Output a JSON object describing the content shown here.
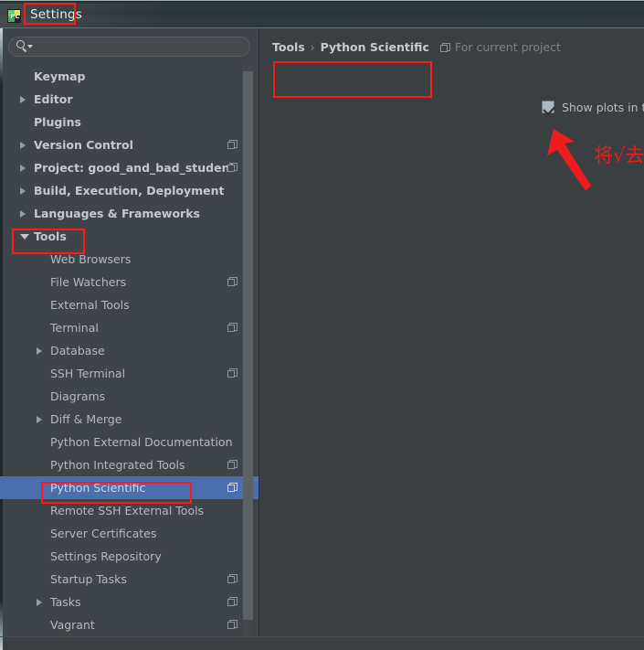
{
  "window": {
    "title": "Settings",
    "app_icon": "pycharm-icon",
    "app_icon_text": "PC"
  },
  "sidebar": {
    "search": {
      "value": "",
      "placeholder": "",
      "icon": "search-icon",
      "dropdown_icon": "chevron-down-icon"
    },
    "items": [
      {
        "label": "Keymap",
        "level": "root",
        "arrow": "none",
        "copy_icon": false,
        "selected": false
      },
      {
        "label": "Editor",
        "level": "root",
        "arrow": "collapsed",
        "copy_icon": false,
        "selected": false
      },
      {
        "label": "Plugins",
        "level": "root",
        "arrow": "none",
        "copy_icon": false,
        "selected": false
      },
      {
        "label": "Version Control",
        "level": "root",
        "arrow": "collapsed",
        "copy_icon": true,
        "selected": false
      },
      {
        "label": "Project: good_and_bad_student",
        "level": "root",
        "arrow": "collapsed",
        "copy_icon": true,
        "selected": false
      },
      {
        "label": "Build, Execution, Deployment",
        "level": "root",
        "arrow": "collapsed",
        "copy_icon": false,
        "selected": false
      },
      {
        "label": "Languages & Frameworks",
        "level": "root",
        "arrow": "collapsed",
        "copy_icon": false,
        "selected": false
      },
      {
        "label": "Tools",
        "level": "root",
        "arrow": "expanded",
        "copy_icon": false,
        "selected": false
      },
      {
        "label": "Web Browsers",
        "level": "child",
        "arrow": "none",
        "copy_icon": false,
        "selected": false
      },
      {
        "label": "File Watchers",
        "level": "child",
        "arrow": "none",
        "copy_icon": true,
        "selected": false
      },
      {
        "label": "External Tools",
        "level": "child",
        "arrow": "none",
        "copy_icon": false,
        "selected": false
      },
      {
        "label": "Terminal",
        "level": "child",
        "arrow": "none",
        "copy_icon": true,
        "selected": false
      },
      {
        "label": "Database",
        "level": "child",
        "arrow": "collapsed",
        "copy_icon": false,
        "selected": false
      },
      {
        "label": "SSH Terminal",
        "level": "child",
        "arrow": "none",
        "copy_icon": true,
        "selected": false
      },
      {
        "label": "Diagrams",
        "level": "child",
        "arrow": "none",
        "copy_icon": false,
        "selected": false
      },
      {
        "label": "Diff & Merge",
        "level": "child",
        "arrow": "collapsed",
        "copy_icon": false,
        "selected": false
      },
      {
        "label": "Python External Documentation",
        "level": "child",
        "arrow": "none",
        "copy_icon": false,
        "selected": false
      },
      {
        "label": "Python Integrated Tools",
        "level": "child",
        "arrow": "none",
        "copy_icon": true,
        "selected": false
      },
      {
        "label": "Python Scientific",
        "level": "child",
        "arrow": "none",
        "copy_icon": true,
        "selected": true
      },
      {
        "label": "Remote SSH External Tools",
        "level": "child",
        "arrow": "none",
        "copy_icon": false,
        "selected": false
      },
      {
        "label": "Server Certificates",
        "level": "child",
        "arrow": "none",
        "copy_icon": false,
        "selected": false
      },
      {
        "label": "Settings Repository",
        "level": "child",
        "arrow": "none",
        "copy_icon": false,
        "selected": false
      },
      {
        "label": "Startup Tasks",
        "level": "child",
        "arrow": "none",
        "copy_icon": true,
        "selected": false
      },
      {
        "label": "Tasks",
        "level": "child",
        "arrow": "collapsed",
        "copy_icon": true,
        "selected": false
      },
      {
        "label": "Vagrant",
        "level": "child",
        "arrow": "none",
        "copy_icon": true,
        "selected": false
      }
    ],
    "scrollbar": {
      "name": "sidebar-scrollbar"
    }
  },
  "panel": {
    "breadcrumb": {
      "parent": "Tools",
      "separator": "›",
      "current": "Python Scientific"
    },
    "scope": {
      "icon": "project-scope-icon",
      "label": "For current project"
    },
    "checkbox": {
      "label": "Show plots in toolwindow",
      "checked": true,
      "check_glyph": "check-icon"
    }
  },
  "annotations": {
    "text": "将√去除",
    "color": "#ee1c1c",
    "arrow": "up-left-arrow",
    "highlight_boxes": [
      "settings-title",
      "tools-node",
      "python-scientific-node",
      "show-plots-checkbox"
    ]
  },
  "colors": {
    "annotation_red": "#ff1a1a",
    "selection_blue": "#4b6eaf",
    "sidebar_bg": "#3f434a",
    "panel_bg": "#3c3f41",
    "titlebar_bg": "#2b3337",
    "text": "#b9bcbd"
  }
}
